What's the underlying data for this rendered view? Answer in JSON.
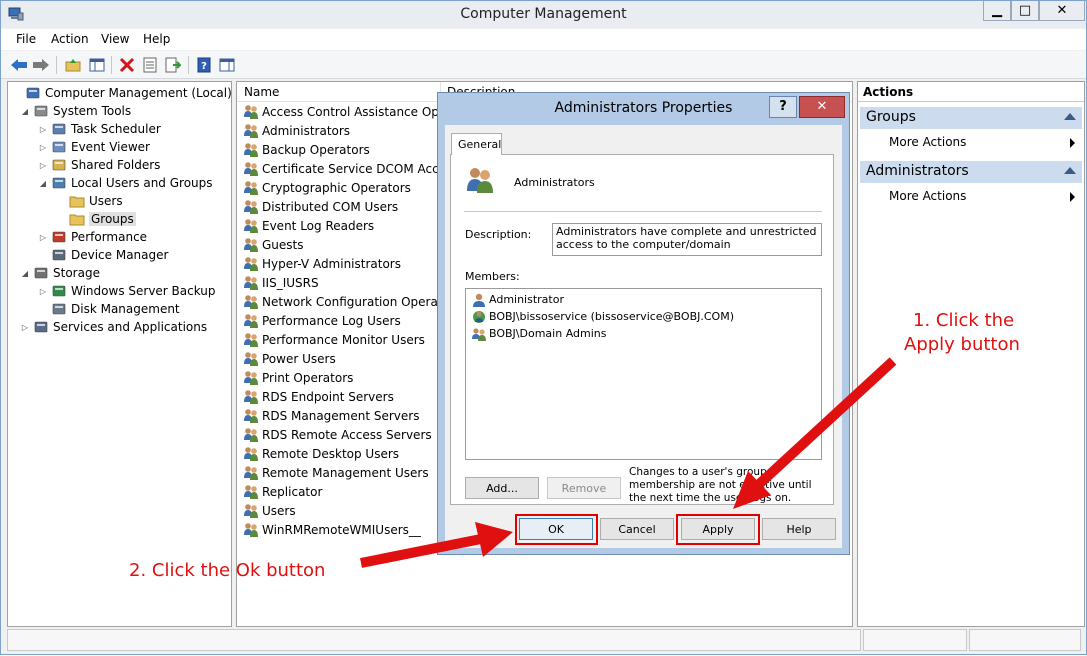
{
  "window": {
    "title": "Computer Management"
  },
  "menu": [
    "File",
    "Action",
    "View",
    "Help"
  ],
  "tree": {
    "items": [
      {
        "label": "Computer Management (Local)",
        "icon": "computer-management-icon",
        "expander": ""
      },
      {
        "label": "System Tools",
        "icon": "system-tools-icon",
        "expander": "◢"
      },
      {
        "label": "Task Scheduler",
        "icon": "clock-icon",
        "expander": "▷"
      },
      {
        "label": "Event Viewer",
        "icon": "event-viewer-icon",
        "expander": "▷"
      },
      {
        "label": "Shared Folders",
        "icon": "shared-folder-icon",
        "expander": "▷"
      },
      {
        "label": "Local Users and Groups",
        "icon": "users-icon",
        "expander": "◢"
      },
      {
        "label": "Users",
        "icon": "folder-icon",
        "expander": ""
      },
      {
        "label": "Groups",
        "icon": "folder-icon",
        "expander": ""
      },
      {
        "label": "Performance",
        "icon": "performance-icon",
        "expander": "▷"
      },
      {
        "label": "Device Manager",
        "icon": "device-manager-icon",
        "expander": ""
      },
      {
        "label": "Storage",
        "icon": "storage-icon",
        "expander": "◢"
      },
      {
        "label": "Windows Server Backup",
        "icon": "backup-icon",
        "expander": "▷"
      },
      {
        "label": "Disk Management",
        "icon": "disk-icon",
        "expander": ""
      },
      {
        "label": "Services and Applications",
        "icon": "services-icon",
        "expander": "▷"
      }
    ]
  },
  "list": {
    "columns": [
      "Name",
      "Description"
    ],
    "rows": [
      "Access Control Assistance Oper...",
      "Administrators",
      "Backup Operators",
      "Certificate Service DCOM Access",
      "Cryptographic Operators",
      "Distributed COM Users",
      "Event Log Readers",
      "Guests",
      "Hyper-V Administrators",
      "IIS_IUSRS",
      "Network Configuration Operators",
      "Performance Log Users",
      "Performance Monitor Users",
      "Power Users",
      "Print Operators",
      "RDS Endpoint Servers",
      "RDS Management Servers",
      "RDS Remote Access Servers",
      "Remote Desktop Users",
      "Remote Management Users",
      "Replicator",
      "Users",
      "WinRMRemoteWMIUsers__"
    ]
  },
  "actions": {
    "header": "Actions",
    "sections": [
      {
        "title": "Groups",
        "item": "More Actions"
      },
      {
        "title": "Administrators",
        "item": "More Actions"
      }
    ]
  },
  "dialog": {
    "title": "Administrators Properties",
    "help_glyph": "?",
    "close_glyph": "✕",
    "tab": "General",
    "group_name": "Administrators",
    "description_label": "Description:",
    "description_value": "Administrators have complete and unrestricted access to the computer/domain",
    "members_label": "Members:",
    "members": [
      "Administrator",
      "BOBJ\\bissoservice (bissoservice@BOBJ.COM)",
      "BOBJ\\Domain Admins"
    ],
    "add_label": "Add...",
    "remove_label": "Remove",
    "note": "Changes to a user's group membership are not effective until the next time the user logs on.",
    "ok_label": "OK",
    "cancel_label": "Cancel",
    "apply_label": "Apply",
    "help_label": "Help"
  },
  "annotations": {
    "step1_line1": "1. Click the",
    "step1_line2": "Apply button",
    "step2": "2. Click the Ok button",
    "color": "#e01010"
  }
}
